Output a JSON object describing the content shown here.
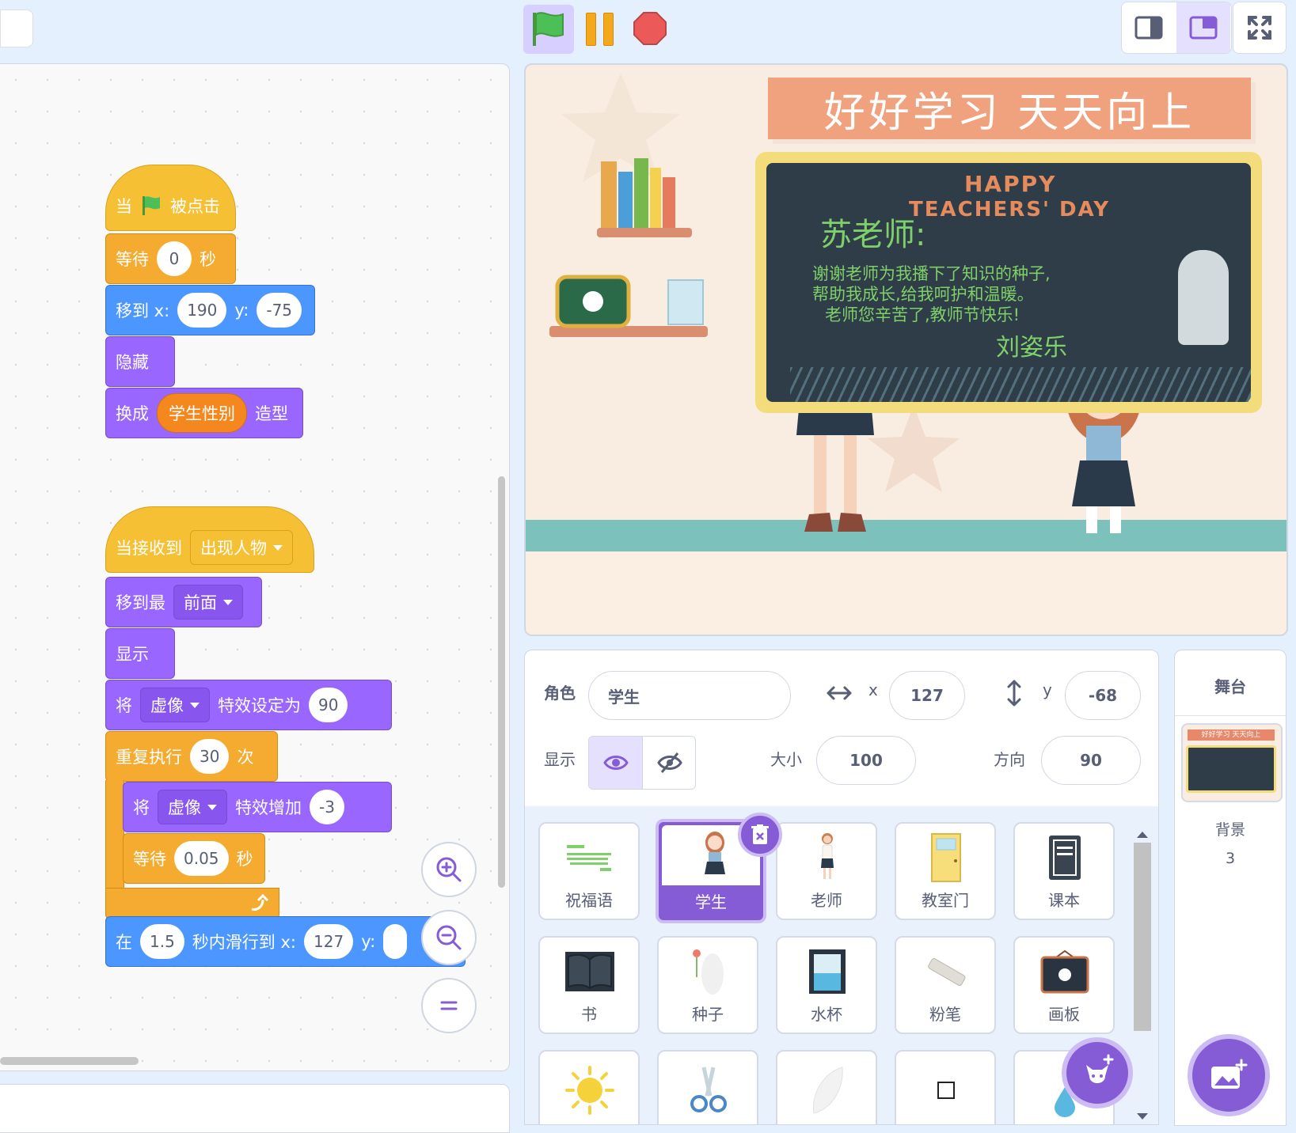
{
  "code": {
    "script1": {
      "hat_prefix": "当",
      "hat_suffix": "被点击",
      "wait_label": "等待",
      "wait_value": "0",
      "wait_unit": "秒",
      "goto_label": "移到 x:",
      "goto_x": "190",
      "goto_y_label": "y:",
      "goto_y": "-75",
      "hide_label": "隐藏",
      "switch_label": "换成",
      "switch_reporter": "学生性别",
      "switch_suffix": "造型"
    },
    "script2": {
      "hat_label": "当接收到",
      "hat_message": "出现人物",
      "front_label": "移到最",
      "front_value": "前面",
      "show_label": "显示",
      "set_effect_prefix": "将",
      "set_effect_name": "虚像",
      "set_effect_label": "特效设定为",
      "set_effect_value": "90",
      "repeat_label": "重复执行",
      "repeat_count": "30",
      "repeat_unit": "次",
      "change_prefix": "将",
      "change_effect_name": "虚像",
      "change_label": "特效增加",
      "change_value": "-3",
      "inner_wait_label": "等待",
      "inner_wait_value": "0.05",
      "inner_wait_unit": "秒",
      "glide_prefix": "在",
      "glide_secs": "1.5",
      "glide_label": "秒内滑行到 x:",
      "glide_x": "127",
      "glide_y_label": "y:"
    }
  },
  "stage": {
    "banner": "好好学习   天天向上",
    "board_happy": "HAPPY",
    "board_teachers_day": "TEACHERS' DAY",
    "board_greeting": "苏老师:",
    "board_line1": "谢谢老师为我播下了知识的种子,",
    "board_line2": "帮助我成长,给我呵护和温暖。",
    "board_line3": "老师您辛苦了,教师节快乐!",
    "board_signature": "刘姿乐"
  },
  "sprite_info": {
    "sprite_label": "角色",
    "sprite_name": "学生",
    "x_label": "x",
    "x_value": "127",
    "y_label": "y",
    "y_value": "-68",
    "show_label": "显示",
    "size_label": "大小",
    "size_value": "100",
    "direction_label": "方向",
    "direction_value": "90"
  },
  "sprites": [
    {
      "name": "祝福语",
      "icon": "text-sprite-icon"
    },
    {
      "name": "学生",
      "icon": "student-sprite-icon",
      "selected": true
    },
    {
      "name": "老师",
      "icon": "teacher-sprite-icon"
    },
    {
      "name": "教室门",
      "icon": "door-sprite-icon"
    },
    {
      "name": "课本",
      "icon": "textbook-sprite-icon"
    },
    {
      "name": "书",
      "icon": "book-sprite-icon"
    },
    {
      "name": "种子",
      "icon": "seed-sprite-icon"
    },
    {
      "name": "水杯",
      "icon": "cup-sprite-icon"
    },
    {
      "name": "粉笔",
      "icon": "chalk-sprite-icon"
    },
    {
      "name": "画板",
      "icon": "drawing-board-sprite-icon"
    },
    {
      "name": "",
      "icon": "sun-sprite-icon"
    },
    {
      "name": "",
      "icon": "scissors-sprite-icon"
    },
    {
      "name": "",
      "icon": "leaf-sprite-icon"
    },
    {
      "name": "",
      "icon": "square-sprite-icon"
    },
    {
      "name": "",
      "icon": "drop-sprite-icon"
    }
  ],
  "stage_panel": {
    "title": "舞台",
    "thumb_banner": "好好学习  天天向上",
    "backdrops_label": "背景",
    "backdrops_count": "3"
  },
  "colors": {
    "events": "#f6c035",
    "control": "#f5ab30",
    "motion": "#4c97ff",
    "looks": "#9966ff",
    "operators": "#f4881f",
    "accent": "#855cd6"
  }
}
